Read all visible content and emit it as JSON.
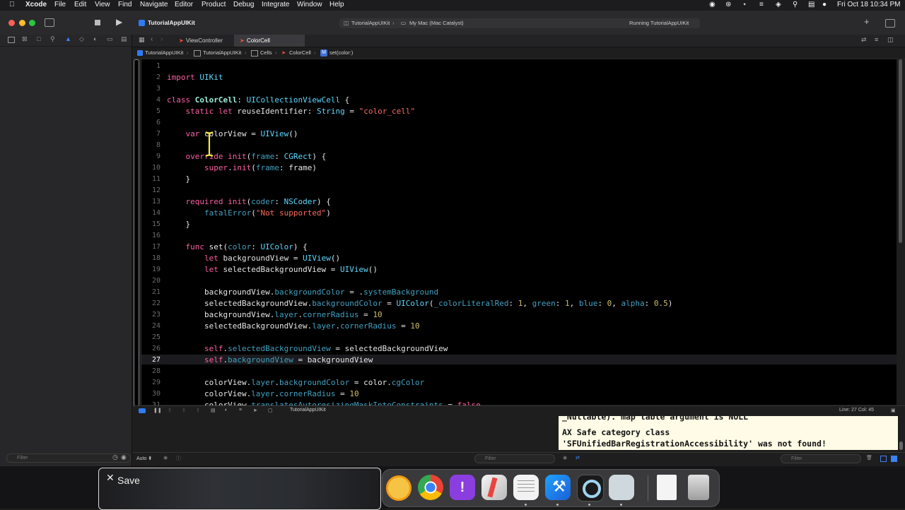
{
  "menubar": {
    "app": "Xcode",
    "items": [
      "File",
      "Edit",
      "View",
      "Find",
      "Navigate",
      "Editor",
      "Product",
      "Debug",
      "Integrate",
      "Window",
      "Help"
    ],
    "clock": "Fri Oct 18  10:34 PM"
  },
  "toolbar": {
    "project": "TutorialAppUIKit",
    "scheme": "TutorialAppUIKit",
    "destination": "My Mac (Mac Catalyst)",
    "status": "Running TutorialAppUIKit"
  },
  "tabs": [
    "ViewController",
    "ColorCell"
  ],
  "breadcrumb": [
    "TutorialAppUIKit",
    "TutorialAppUIKit",
    "Cells",
    "ColorCell",
    "set(color:)"
  ],
  "code_lines": [
    {
      "n": "1",
      "t": ""
    },
    {
      "n": "2",
      "t": "import UIKit"
    },
    {
      "n": "3",
      "t": ""
    },
    {
      "n": "4",
      "t": "class ColorCell: UICollectionViewCell {"
    },
    {
      "n": "5",
      "t": "    static let reuseIdentifier: String = \"color_cell\""
    },
    {
      "n": "6",
      "t": ""
    },
    {
      "n": "7",
      "t": "    var colorView = UIView()"
    },
    {
      "n": "8",
      "t": ""
    },
    {
      "n": "9",
      "t": "    override init(frame: CGRect) {"
    },
    {
      "n": "10",
      "t": "        super.init(frame: frame)"
    },
    {
      "n": "11",
      "t": "    }"
    },
    {
      "n": "12",
      "t": ""
    },
    {
      "n": "13",
      "t": "    required init(coder: NSCoder) {"
    },
    {
      "n": "14",
      "t": "        fatalError(\"Not supported\")"
    },
    {
      "n": "15",
      "t": "    }"
    },
    {
      "n": "16",
      "t": ""
    },
    {
      "n": "17",
      "t": "    func set(color: UIColor) {"
    },
    {
      "n": "18",
      "t": "        let backgroundView = UIView()"
    },
    {
      "n": "19",
      "t": "        let selectedBackgroundView = UIView()"
    },
    {
      "n": "20",
      "t": ""
    },
    {
      "n": "21",
      "t": "        backgroundView.backgroundColor = .systemBackground"
    },
    {
      "n": "22",
      "t": "        selectedBackgroundView.backgroundColor = UIColor(_colorLiteralRed: 1, green: 1, blue: 0, alpha: 0.5)"
    },
    {
      "n": "23",
      "t": "        backgroundView.layer.cornerRadius = 10"
    },
    {
      "n": "24",
      "t": "        selectedBackgroundView.layer.cornerRadius = 10"
    },
    {
      "n": "25",
      "t": ""
    },
    {
      "n": "26",
      "t": "        self.selectedBackgroundView = selectedBackgroundView"
    },
    {
      "n": "27",
      "t": "        self.backgroundView = backgroundView"
    },
    {
      "n": "28",
      "t": ""
    },
    {
      "n": "29",
      "t": "        colorView.layer.backgroundColor = color.cgColor"
    },
    {
      "n": "30",
      "t": "        colorView.layer.cornerRadius = 10"
    },
    {
      "n": "31",
      "t": "        colorView.translatesAutoresizingMaskIntoConstraints = false"
    }
  ],
  "current_line": "27",
  "debugbar": {
    "target": "TutorialAppUIKit",
    "position": "Line: 27  Col: 45"
  },
  "console": {
    "lines": [
      "_Nullable). map table argument is NULL",
      "AX Safe category class",
      "'SFUnifiedBarRegistrationAccessibility' was not found!"
    ]
  },
  "bottombar": {
    "auto": "Auto ⬍",
    "filter": "Filter"
  },
  "sidebar_filter": "Filter",
  "save_popup": {
    "label": "Save"
  },
  "colors": {
    "keyword": "#fc5fa3",
    "type": "#5dd8ff",
    "string": "#fc6a5d",
    "number": "#d0bf69",
    "console_bg": "#fffbe6"
  }
}
